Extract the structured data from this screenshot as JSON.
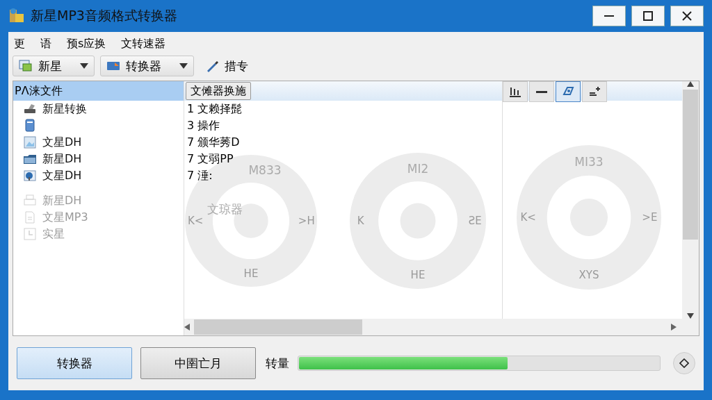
{
  "window": {
    "title": "新星MP3音频格式转换器"
  },
  "menu": [
    "更",
    "语",
    "预s应换",
    "文转速器"
  ],
  "toolbar": [
    {
      "label": "新星",
      "kind": "dropdown"
    },
    {
      "label": "转换器",
      "kind": "dropdown"
    },
    {
      "label": "措专",
      "kind": "button"
    }
  ],
  "sidebar": {
    "header": "PΛ涞文件",
    "items": [
      {
        "label": "新星转换",
        "disabled": false
      },
      {
        "disabled": false
      },
      {
        "label": "文星DH",
        "disabled": false
      },
      {
        "label": "新星DH",
        "disabled": false
      },
      {
        "label": "文星DH",
        "disabled": false
      },
      {
        "label": "新星DH",
        "disabled": true
      },
      {
        "label": "文星MP3",
        "disabled": true
      },
      {
        "label": "实星",
        "disabled": true
      }
    ]
  },
  "list": {
    "header": "文傩器换施",
    "rows": [
      "1 文赖择髭",
      "3 操作",
      "7 颁华莠D",
      "7 文弱PP",
      "7 涶:"
    ]
  },
  "tools": [
    {
      "selected": false
    },
    {
      "selected": false
    },
    {
      "selected": true
    },
    {
      "selected": false
    }
  ],
  "wheels": [
    {
      "title": "M833",
      "left": "K<",
      "right": ">H",
      "bottom": "HE",
      "caption": "文琼器"
    },
    {
      "title": "MI2",
      "left": "K",
      "right": "ƧE",
      "bottom": "HE"
    },
    {
      "title": "MI33",
      "left": "K<",
      "right": ">E",
      "bottom": "XYS"
    }
  ],
  "footer": {
    "buttons": [
      {
        "label": "转换器",
        "selected": true
      },
      {
        "label": "中圉亡月",
        "selected": false
      }
    ],
    "progress_label": "转量",
    "level": 0.58
  }
}
